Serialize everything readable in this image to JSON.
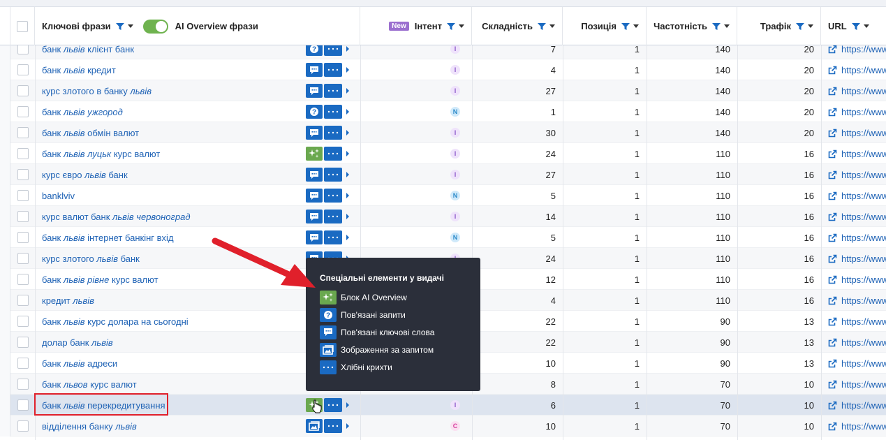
{
  "header": {
    "keywords_label": "Ключові фрази",
    "ai_overview_label": "AI Overview фрази",
    "new_badge": "New",
    "intent_label": "Інтент",
    "difficulty_label": "Складність",
    "position_label": "Позиція",
    "volume_label": "Частотність",
    "traffic_label": "Трафік",
    "url_label": "URL"
  },
  "rows": [
    {
      "kw_parts": [
        "банк ",
        "львів",
        " клієнт банк"
      ],
      "serp": "q",
      "intent": "I",
      "kd": "7",
      "pos": "1",
      "vol": "140",
      "traffic": "20",
      "url": "https://www"
    },
    {
      "kw_parts": [
        "банк ",
        "львів",
        " кредит"
      ],
      "serp": "kw",
      "intent": "I",
      "kd": "4",
      "pos": "1",
      "vol": "140",
      "traffic": "20",
      "url": "https://www"
    },
    {
      "kw_parts": [
        "курс злотого в банку ",
        "львів",
        ""
      ],
      "serp": "kw",
      "intent": "I",
      "kd": "27",
      "pos": "1",
      "vol": "140",
      "traffic": "20",
      "url": "https://www"
    },
    {
      "kw_parts": [
        "банк ",
        "львів ужгород",
        ""
      ],
      "serp": "q",
      "intent": "N",
      "kd": "1",
      "pos": "1",
      "vol": "140",
      "traffic": "20",
      "url": "https://www"
    },
    {
      "kw_parts": [
        "банк ",
        "львів",
        " обмін валют"
      ],
      "serp": "kw",
      "intent": "I",
      "kd": "30",
      "pos": "1",
      "vol": "140",
      "traffic": "20",
      "url": "https://www"
    },
    {
      "kw_parts": [
        "банк ",
        "львів луцьк",
        " курс валют"
      ],
      "serp": "ai",
      "intent": "I",
      "kd": "24",
      "pos": "1",
      "vol": "110",
      "traffic": "16",
      "url": "https://www"
    },
    {
      "kw_parts": [
        "курс євро ",
        "львів",
        " банк"
      ],
      "serp": "kw",
      "intent": "I",
      "kd": "27",
      "pos": "1",
      "vol": "110",
      "traffic": "16",
      "url": "https://www"
    },
    {
      "kw_parts": [
        "banklviv",
        "",
        ""
      ],
      "serp": "kw",
      "intent": "N",
      "kd": "5",
      "pos": "1",
      "vol": "110",
      "traffic": "16",
      "url": "https://www"
    },
    {
      "kw_parts": [
        "курс валют банк ",
        "львів червоноград",
        ""
      ],
      "serp": "kw",
      "intent": "I",
      "kd": "14",
      "pos": "1",
      "vol": "110",
      "traffic": "16",
      "url": "https://www"
    },
    {
      "kw_parts": [
        "банк ",
        "львів",
        " інтернет банкінг вхід"
      ],
      "serp": "kw",
      "intent": "N",
      "kd": "5",
      "pos": "1",
      "vol": "110",
      "traffic": "16",
      "url": "https://www"
    },
    {
      "kw_parts": [
        "курс злотого ",
        "львів",
        " банк"
      ],
      "serp": "kw",
      "intent": "I",
      "kd": "24",
      "pos": "1",
      "vol": "110",
      "traffic": "16",
      "url": "https://www"
    },
    {
      "kw_parts": [
        "банк ",
        "львів рівне",
        " курс валют"
      ],
      "serp": "",
      "intent": "",
      "kd": "12",
      "pos": "1",
      "vol": "110",
      "traffic": "16",
      "url": "https://www"
    },
    {
      "kw_parts": [
        "кредит ",
        "львів",
        ""
      ],
      "serp": "",
      "intent": "",
      "kd": "4",
      "pos": "1",
      "vol": "110",
      "traffic": "16",
      "url": "https://www"
    },
    {
      "kw_parts": [
        "банк ",
        "львів",
        " курс долара на сьогодні"
      ],
      "serp": "",
      "intent": "",
      "kd": "22",
      "pos": "1",
      "vol": "90",
      "traffic": "13",
      "url": "https://www"
    },
    {
      "kw_parts": [
        "долар банк ",
        "львів",
        ""
      ],
      "serp": "",
      "intent": "",
      "kd": "22",
      "pos": "1",
      "vol": "90",
      "traffic": "13",
      "url": "https://www"
    },
    {
      "kw_parts": [
        "банк ",
        "львів",
        " адреси"
      ],
      "serp": "",
      "intent": "",
      "kd": "10",
      "pos": "1",
      "vol": "90",
      "traffic": "13",
      "url": "https://www"
    },
    {
      "kw_parts": [
        "банк ",
        "львов",
        " курс валют"
      ],
      "serp": "",
      "intent": "",
      "kd": "8",
      "pos": "1",
      "vol": "70",
      "traffic": "10",
      "url": "https://www"
    },
    {
      "kw_parts": [
        "банк ",
        "львів",
        " перекредитування"
      ],
      "serp": "ai",
      "intent": "I",
      "kd": "6",
      "pos": "1",
      "vol": "70",
      "traffic": "10",
      "url": "https://www"
    },
    {
      "kw_parts": [
        "відділення банку ",
        "львів",
        ""
      ],
      "serp": "img",
      "intent": "C",
      "kd": "10",
      "pos": "1",
      "vol": "70",
      "traffic": "10",
      "url": "https://www"
    }
  ],
  "tooltip": {
    "title": "Спеціальні елементи у видачі",
    "items": [
      {
        "icon": "ai",
        "label": "Блок AI Overview"
      },
      {
        "icon": "q",
        "label": "Пов'язані запити"
      },
      {
        "icon": "kw",
        "label": "Пов'язані ключові слова"
      },
      {
        "icon": "img",
        "label": "Зображення за запитом"
      },
      {
        "icon": "more",
        "label": "Хлібні крихти"
      }
    ]
  },
  "colors": {
    "link": "#1e62b5",
    "serp_blue": "#1a6ac2",
    "ai_green": "#6aa84f",
    "highlight_border": "#e0202b",
    "arrow": "#e0202b"
  }
}
